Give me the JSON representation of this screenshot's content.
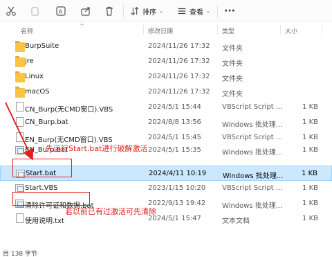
{
  "toolbar": {
    "sort_label": "排序",
    "view_label": "查看"
  },
  "columns": {
    "name": "名称",
    "modified": "修改日期",
    "type": "类型",
    "size": "大小"
  },
  "files": [
    {
      "name": "BurpSuite",
      "date": "2024/11/26 17:32",
      "type": "文件夹",
      "size": "",
      "icon": "folder-icon"
    },
    {
      "name": "jre",
      "date": "2024/11/26 17:32",
      "type": "文件夹",
      "size": "",
      "icon": "folder-icon"
    },
    {
      "name": "Linux",
      "date": "2024/11/26 17:32",
      "type": "文件夹",
      "size": "",
      "icon": "folder-icon"
    },
    {
      "name": "macOS",
      "date": "2024/11/26 17:32",
      "type": "文件夹",
      "size": "",
      "icon": "folder-icon"
    },
    {
      "name": "CN_Burp(无CMD窗口).VBS",
      "date": "2024/5/1 15:44",
      "type": "VBScript Script ...",
      "size": "1 KB",
      "icon": "file-icon"
    },
    {
      "name": "CN_Burp.bat",
      "date": "2024/8/8 13:56",
      "type": "Windows 批处理...",
      "size": "1 KB",
      "icon": "file-icon"
    },
    {
      "name": "EN_Burp(无CMD窗口).VBS",
      "date": "2024/5/1 15:45",
      "type": "VBScript Script ...",
      "size": "1 KB",
      "icon": "file-icon"
    },
    {
      "name": "EN_Burp.bat",
      "date": "2024/5/1 15:35",
      "type": "Windows 批处理...",
      "size": "1 KB",
      "icon": "script-icon"
    },
    {
      "name": "Start.bat",
      "date": "2024/4/11 10:19",
      "type": "Windows 批处理...",
      "size": "1 KB",
      "icon": "script-icon"
    },
    {
      "name": "Start.VBS",
      "date": "2023/1/15 10:20",
      "type": "VBScript Script ...",
      "size": "1 KB",
      "icon": "script-icon"
    },
    {
      "name": "清除许可证和数据.bat",
      "date": "2022/9/13 19:42",
      "type": "Windows 批处理...",
      "size": "1 KB",
      "icon": "script-icon"
    },
    {
      "name": "使用说明.txt",
      "date": "2024/5/1 15:47",
      "type": "文本文档",
      "size": "1 KB",
      "icon": "file-icon"
    }
  ],
  "annotations": {
    "start_note": "先运行Start.bat进行破解激活",
    "clear_note": "若以前已有过激活可先清除"
  },
  "status": {
    "text": "目 138 字节"
  },
  "colors": {
    "selection": "#cce8ff",
    "annotation": "#e02020",
    "folder": "#f8c544"
  }
}
